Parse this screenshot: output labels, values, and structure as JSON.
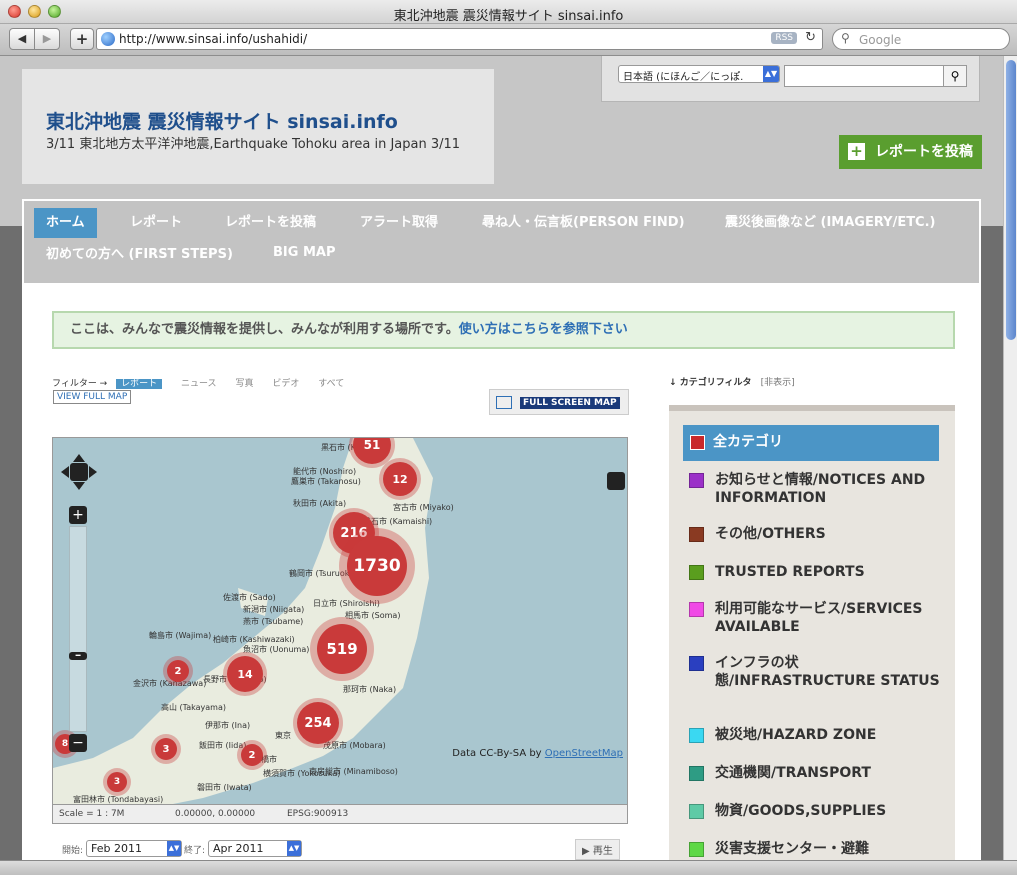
{
  "window": {
    "title": "東北沖地震 震災情報サイト sinsai.info"
  },
  "browser": {
    "url": "http://www.sinsai.info/ushahidi/",
    "rss": "RSS",
    "search_placeholder": "Google"
  },
  "header": {
    "title": "東北沖地震 震災情報サイト sinsai.info",
    "subtitle": "3/11 東北地方太平洋沖地震,Earthquake Tohoku area in Japan 3/11",
    "language_value": "日本語 (にほんご／にっぽ.",
    "post_report_label": "レポートを投稿"
  },
  "nav": {
    "items": [
      "ホーム",
      "レポート",
      "レポートを投稿",
      "アラート取得",
      "尋ね人・伝言板(PERSON FIND)",
      "震災後画像など (IMAGERY/ETC.)",
      "初めての方へ (FIRST STEPS)",
      "BIG MAP"
    ]
  },
  "welcome": {
    "text": "ここは、みんなで震災情報を提供し、みんなが利用する場所です。",
    "link": "使い方はこちらを参照下さい"
  },
  "filters": {
    "label": "フィルター →",
    "items": [
      "レポート",
      "ニュース",
      "写真",
      "ビデオ",
      "すべて"
    ],
    "view_full_map": "VIEW FULL MAP",
    "full_screen_map": "FULL SCREEN MAP"
  },
  "map": {
    "clusters": [
      "51",
      "12",
      "216",
      "1730",
      "519",
      "14",
      "2",
      "254",
      "2",
      "3",
      "8",
      "3"
    ],
    "places": [
      "黒石市 (Kuroishi)",
      "能代市 (Noshiro)",
      "鷹巣市 (Takanosu)",
      "秋田市 (Akita)",
      "宮古市 (Miyako)",
      "釜石市 (Kamaishi)",
      "佐渡市 (Sado)",
      "新潟市 (Niigata)",
      "燕市 (Tsubame)",
      "輪島市 (Wajima)",
      "柏崎市 (Kashiwazaki)",
      "魚沼市 (Uonuma)",
      "金沢市 (Kanazawa)",
      "長野市 (Nagano)",
      "那珂市 (Naka)",
      "高山 (Takayama)",
      "伊那市 (Ina)",
      "茂原市 (Mobara)",
      "飯田市 (Iida)",
      "豊橋市",
      "日立市 (Shiroishi)",
      "相馬市 (Soma)",
      "鶴岡市 (Tsuruoka)",
      "東京",
      "横須賀市 (Yokosuka)",
      "南房総市 (Minamiboso)",
      "富田林市 (Tondabayasi)",
      "磐田市 (Iwata)"
    ],
    "attribution_prefix": "Data CC-By-SA by",
    "attribution_link": "OpenStreetMap",
    "scale": "Scale = 1 : 7M",
    "coords": "0.00000, 0.00000",
    "epsg": "EPSG:900913"
  },
  "timeline": {
    "start_label": "開始:",
    "start_value": "Feb 2011",
    "end_label": "終了:",
    "end_value": "Apr 2011",
    "play_label": "再生"
  },
  "categories": {
    "header": "カテゴリフィルタ",
    "hide": "[非表示]",
    "items": [
      {
        "label": "全カテゴリ",
        "color": "#c8282a"
      },
      {
        "label": "お知らせと情報/NOTICES AND INFORMATION",
        "color": "#9b30c8"
      },
      {
        "label": "その他/OTHERS",
        "color": "#8a3a22"
      },
      {
        "label": "TRUSTED REPORTS",
        "color": "#5a9e1e"
      },
      {
        "label": "利用可能なサービス/SERVICES AVAILABLE",
        "color": "#f04ae6"
      },
      {
        "label": "インフラの状態/INFRASTRUCTURE STATUS",
        "color": "#2a3fc0"
      },
      {
        "label": "被災地/HAZARD ZONE",
        "color": "#3ad8f2"
      },
      {
        "label": "交通機関/TRANSPORT",
        "color": "#2e9c84"
      },
      {
        "label": "物資/GOODS,SUPPLIES",
        "color": "#5ecaa6"
      },
      {
        "label": "災害支援センター・避難",
        "color": "#5ed846"
      }
    ]
  }
}
